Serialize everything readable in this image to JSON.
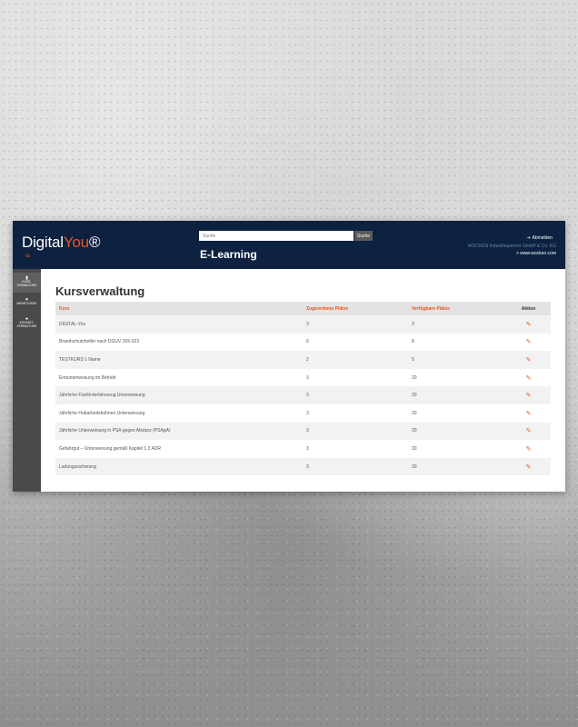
{
  "header": {
    "logo_main": "Digital",
    "logo_accent": "You",
    "logo_mark": "®",
    "menu_icon": "≡",
    "search_placeholder": "Suche",
    "search_button": "Suche",
    "app_title": "E-Learning",
    "logout_icon": "⇥",
    "logout_label": "Abmelden",
    "company": "WOCKEN Industriepartner GmbH & Co. KG",
    "weblink": "> www.wocken.com"
  },
  "sidebar": {
    "items": [
      {
        "icon": "▮",
        "line1": "KURS-",
        "line2": "VERWALTUNG",
        "icon_name": "document-icon"
      },
      {
        "icon": "♥",
        "line1": "MEINE KURSE",
        "line2": "",
        "icon_name": "heart-icon"
      },
      {
        "icon": "●",
        "line1": "KONTAKT-",
        "line2": "VERWALTUNG",
        "icon_name": "user-icon"
      }
    ]
  },
  "main": {
    "title": "Kursverwaltung",
    "columns": [
      "Kurs",
      "Zugeordnete Plätze",
      "Verfügbare Plätze",
      "Aktion"
    ],
    "rows": [
      {
        "kurs": "DIGITAL-You",
        "zugeordnet": "3",
        "verfuegbar": "3",
        "action": "✎"
      },
      {
        "kurs": "Brandschutzhelfer nach DGUV 205-023",
        "zugeordnet": "6",
        "verfuegbar": "8",
        "action": "✎"
      },
      {
        "kurs": "TESTKURS 1 Name",
        "zugeordnet": "2",
        "verfuegbar": "5",
        "action": "✎"
      },
      {
        "kurs": "Erstunterweisung im Betrieb",
        "zugeordnet": "3",
        "verfuegbar": "20",
        "action": "✎"
      },
      {
        "kurs": "Jährliche Flurförderfahrzeug Unterweisung",
        "zugeordnet": "3",
        "verfuegbar": "20",
        "action": "✎"
      },
      {
        "kurs": "Jährliche Hubarbeitsbühnen Unterweisung",
        "zugeordnet": "3",
        "verfuegbar": "20",
        "action": "✎"
      },
      {
        "kurs": "Jährliche Unterweisung in PSA gegen Absturz (PSAgA)",
        "zugeordnet": "3",
        "verfuegbar": "20",
        "action": "✎"
      },
      {
        "kurs": "Gefahrgut – Unterweisung gemäß Kapitel 1.3 ADR",
        "zugeordnet": "3",
        "verfuegbar": "20",
        "action": "✎"
      },
      {
        "kurs": "Ladungssicherung",
        "zugeordnet": "3",
        "verfuegbar": "20",
        "action": "✎"
      }
    ]
  },
  "colors": {
    "header_bg": "#0d2141",
    "accent": "#e8561f",
    "sidebar_bg": "#4a4a4a"
  }
}
